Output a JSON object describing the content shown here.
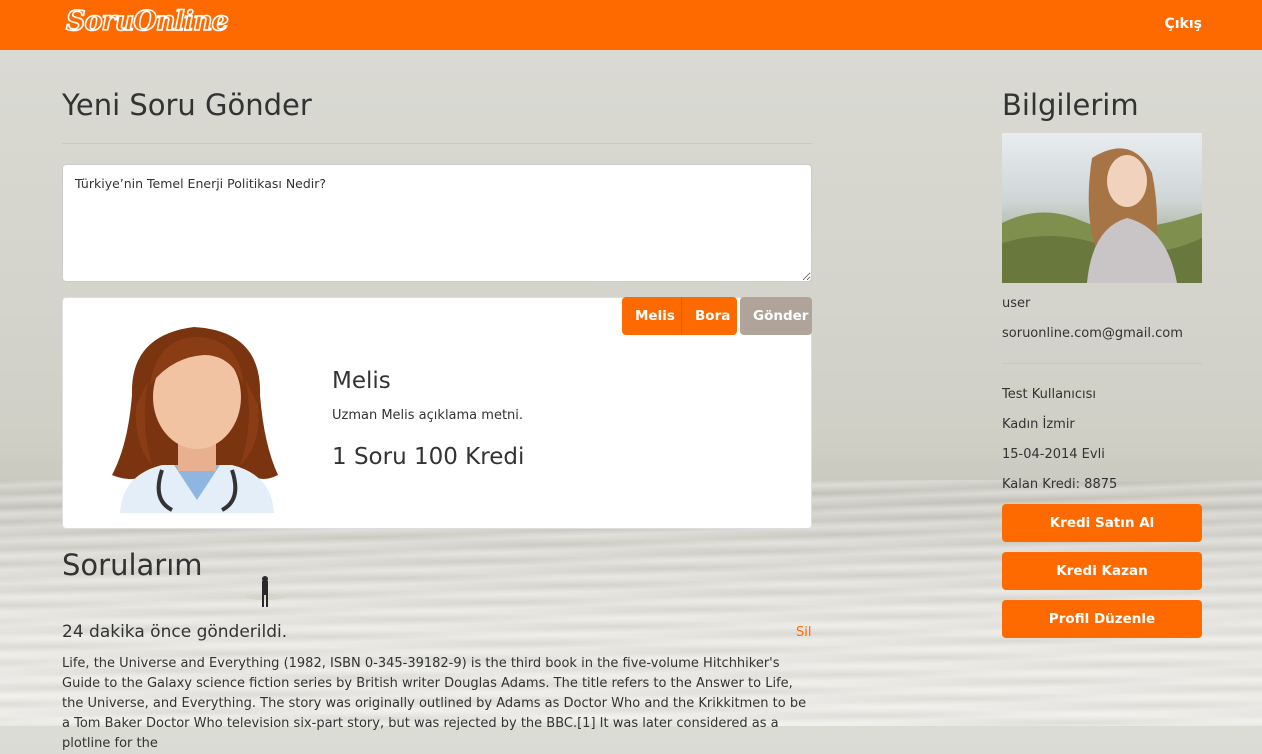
{
  "header": {
    "logo_text": "SoruOnline",
    "logout_label": "Çıkış"
  },
  "new_question": {
    "title": "Yeni Soru Gönder",
    "input_value": "Türkiye’nin Temel Enerji Politikası Nedir?"
  },
  "experts": {
    "tabs": [
      "Melis",
      "Bora"
    ],
    "send_label": "Gönder",
    "selected": {
      "name": "Melis",
      "description": "Uzman Melis açıklama metni.",
      "price": "1 Soru 100 Kredi"
    }
  },
  "questions": {
    "title": "Sorularım",
    "items": [
      {
        "time": "24 dakika önce gönderildi.",
        "delete_label": "Sil",
        "body": "Life, the Universe and Everything (1982, ISBN 0-345-39182-9) is the third book in the five-volume Hitchhiker's Guide to the Galaxy science fiction series by British writer Douglas Adams. The title refers to the Answer to Life, the Universe, and Everything. The story was originally outlined by Adams as Doctor Who and the Krikkitmen to be a Tom Baker Doctor Who television six-part story, but was rejected by the BBC.[1] It was later considered as a plotline for the"
      }
    ]
  },
  "profile": {
    "title": "Bilgilerim",
    "username": "user",
    "email": "soruonline.com@gmail.com",
    "full_name": "Test Kullanıcısı",
    "gender_city": "Kadın İzmir",
    "birth_marital": "15-04-2014 Evli",
    "credit": "Kalan Kredi: 8875",
    "buttons": {
      "buy_credit": "Kredi Satın Al",
      "earn_credit": "Kredi Kazan",
      "edit_profile": "Profil Düzenle"
    }
  },
  "colors": {
    "accent": "#ff6a00",
    "send_button": "#b0a49a"
  }
}
